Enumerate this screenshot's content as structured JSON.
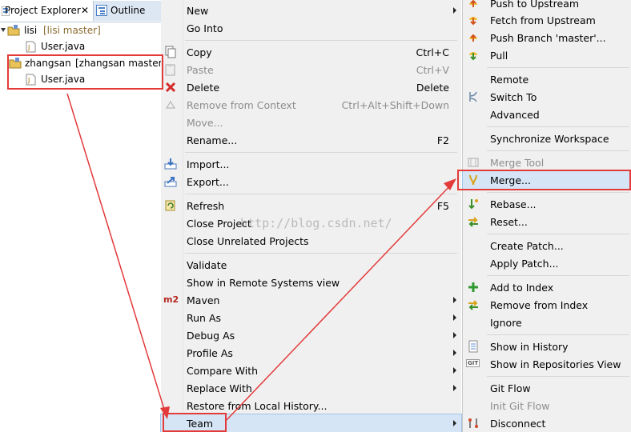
{
  "explorer": {
    "tabs": [
      {
        "label": "Project Explorer",
        "close": "✕"
      },
      {
        "label": "Outline"
      }
    ],
    "tree": [
      {
        "name": "lisi",
        "decoration": "[lisi master]",
        "child": "User.java"
      },
      {
        "name": "zhangsan",
        "decoration": "[zhangsan master",
        "child": "User.java"
      }
    ]
  },
  "menu": {
    "new": "New",
    "go_into": "Go Into",
    "copy": "Copy",
    "copy_key": "Ctrl+C",
    "paste": "Paste",
    "paste_key": "Ctrl+V",
    "delete": "Delete",
    "delete_key": "Delete",
    "remove_ctx": "Remove from Context",
    "remove_ctx_key": "Ctrl+Alt+Shift+Down",
    "move": "Move...",
    "rename": "Rename...",
    "rename_key": "F2",
    "import": "Import...",
    "export": "Export...",
    "refresh": "Refresh",
    "refresh_key": "F5",
    "close_project": "Close Project",
    "close_unrelated": "Close Unrelated Projects",
    "validate": "Validate",
    "show_remote": "Show in Remote Systems view",
    "maven": "Maven",
    "maven_badge": "m2",
    "run_as": "Run As",
    "debug_as": "Debug As",
    "profile_as": "Profile As",
    "compare_with": "Compare With",
    "replace_with": "Replace With",
    "restore_history": "Restore from Local History...",
    "team": "Team"
  },
  "submenu": {
    "push_upstream": "Push to Upstream",
    "fetch_upstream": "Fetch from Upstream",
    "push_branch": "Push Branch 'master'...",
    "pull": "Pull",
    "remote": "Remote",
    "switch_to": "Switch To",
    "advanced": "Advanced",
    "sync_workspace": "Synchronize Workspace",
    "merge_tool": "Merge Tool",
    "merge": "Merge...",
    "rebase": "Rebase...",
    "reset": "Reset...",
    "create_patch": "Create Patch...",
    "apply_patch": "Apply Patch...",
    "add_index": "Add to Index",
    "remove_index": "Remove from Index",
    "ignore": "Ignore",
    "show_history": "Show in History",
    "show_repos": "Show in Repositories View",
    "git_badge": "GIT",
    "git_flow": "Git Flow",
    "init_git_flow": "Init Git Flow",
    "disconnect": "Disconnect"
  },
  "watermark": "http://blog.csdn.net/",
  "colors": {
    "annotation": "#e33a3a",
    "menu_bg": "#f0f0f0",
    "highlight": "#d6e5f5"
  }
}
